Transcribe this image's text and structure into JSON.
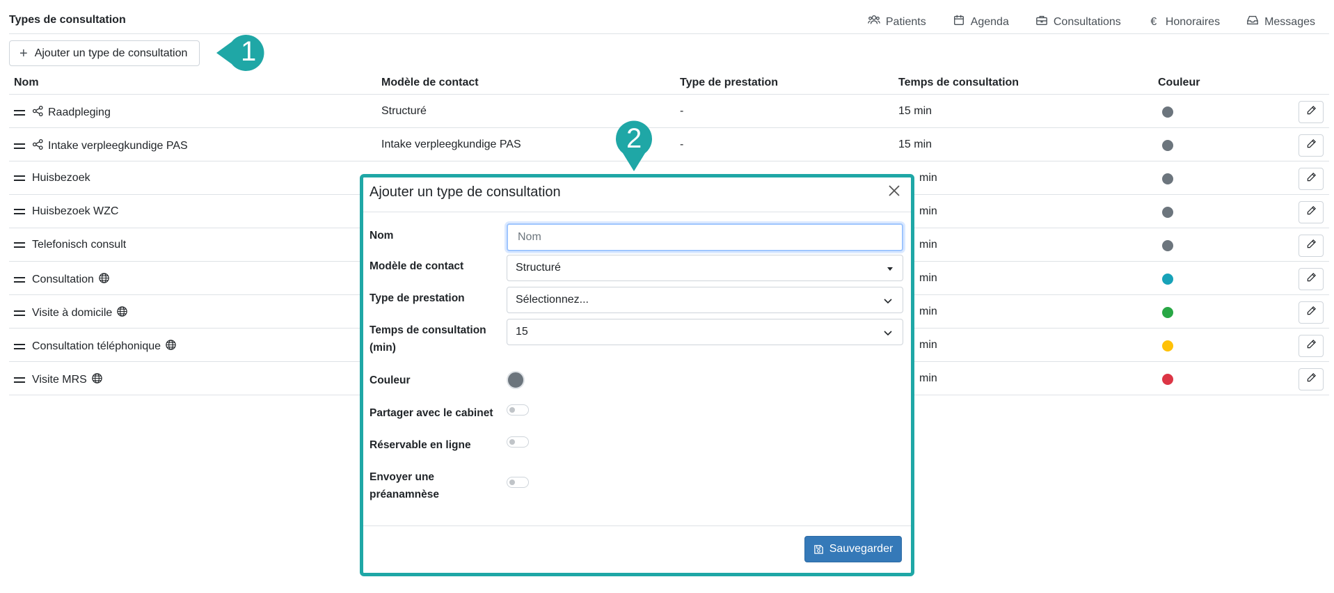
{
  "header": {
    "title": "Types de consultation",
    "nav": [
      {
        "label": "Patients",
        "icon": "people-icon"
      },
      {
        "label": "Agenda",
        "icon": "calendar-icon"
      },
      {
        "label": "Consultations",
        "icon": "briefcase-icon"
      },
      {
        "label": "Honoraires",
        "icon": "euro-icon"
      },
      {
        "label": "Messages",
        "icon": "inbox-icon"
      }
    ]
  },
  "toolbar": {
    "add_label": "Ajouter un type de consultation"
  },
  "callouts": {
    "one": "1",
    "two": "2",
    "color": "#1fa7a6"
  },
  "table": {
    "headers": [
      "Nom",
      "Modèle de contact",
      "Type de prestation",
      "Temps de consultation",
      "Couleur"
    ],
    "rows": [
      {
        "name": "Raadpleging",
        "model": "Structuré",
        "type": "-",
        "time": "15 min",
        "color": "#6c757d",
        "shared": true,
        "globe": false
      },
      {
        "name": "Intake verpleegkundige PAS",
        "model": "Intake verpleegkundige PAS",
        "type": "-",
        "time": "15 min",
        "color": "#6c757d",
        "shared": true,
        "globe": false
      },
      {
        "name": "Huisbezoek",
        "model": "",
        "type": "",
        "time": "min",
        "color": "#6c757d",
        "shared": false,
        "globe": false
      },
      {
        "name": "Huisbezoek WZC",
        "model": "",
        "type": "",
        "time": "min",
        "color": "#6c757d",
        "shared": false,
        "globe": false
      },
      {
        "name": "Telefonisch consult",
        "model": "",
        "type": "",
        "time": "min",
        "color": "#6c757d",
        "shared": false,
        "globe": false
      },
      {
        "name": "Consultation",
        "model": "",
        "type": "",
        "time": "min",
        "color": "#17a2b8",
        "shared": false,
        "globe": true
      },
      {
        "name": "Visite à domicile",
        "model": "",
        "type": "",
        "time": "min",
        "color": "#28a745",
        "shared": false,
        "globe": true
      },
      {
        "name": "Consultation téléphonique",
        "model": "",
        "type": "",
        "time": "min",
        "color": "#ffc107",
        "shared": false,
        "globe": true
      },
      {
        "name": "Visite MRS",
        "model": "",
        "type": "",
        "time": "min",
        "color": "#dc3545",
        "shared": false,
        "globe": true
      }
    ]
  },
  "modal": {
    "title": "Ajouter un type de consultation",
    "fields": {
      "name_label": "Nom",
      "name_placeholder": "Nom",
      "model_label": "Modèle de contact",
      "model_value": "Structuré",
      "type_label": "Type de prestation",
      "type_value": "Sélectionnez...",
      "time_label_1": "Temps de consultation",
      "time_label_2": "(min)",
      "time_value": "15",
      "color_label": "Couleur",
      "color_value": "#6c757d",
      "share_label": "Partager avec le cabinet",
      "online_label": "Réservable en ligne",
      "pre_label_1": "Envoyer une",
      "pre_label_2": "préanamnèse"
    },
    "save_label": "Sauvegarder"
  }
}
